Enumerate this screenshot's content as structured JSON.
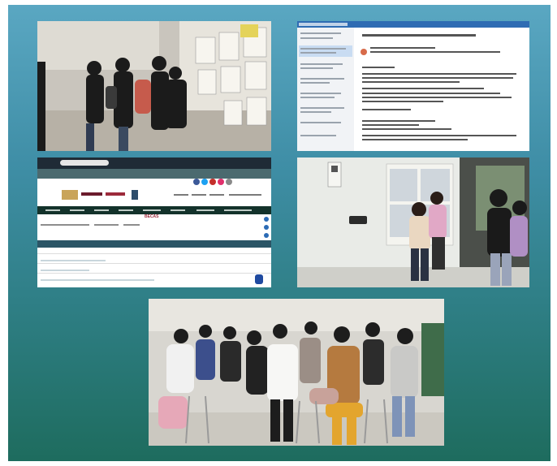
{
  "photos": [
    {
      "id": "students-reading-posted-lists",
      "icon": "photo-icon"
    },
    {
      "id": "email-client-screenshot",
      "icon": "email-icon"
    },
    {
      "id": "education-website-screenshot",
      "icon": "webpage-icon"
    },
    {
      "id": "students-checking-bulletin-board",
      "icon": "photo-icon"
    },
    {
      "id": "students-seated-in-room",
      "icon": "photo-icon"
    }
  ],
  "website": {
    "page_title": "BECAS"
  },
  "colors": {
    "gradient_top": "#5aa7c2",
    "gradient_bottom": "#1e6c5e",
    "website_nav": "#13322b",
    "website_accent": "#9c2a3b"
  }
}
